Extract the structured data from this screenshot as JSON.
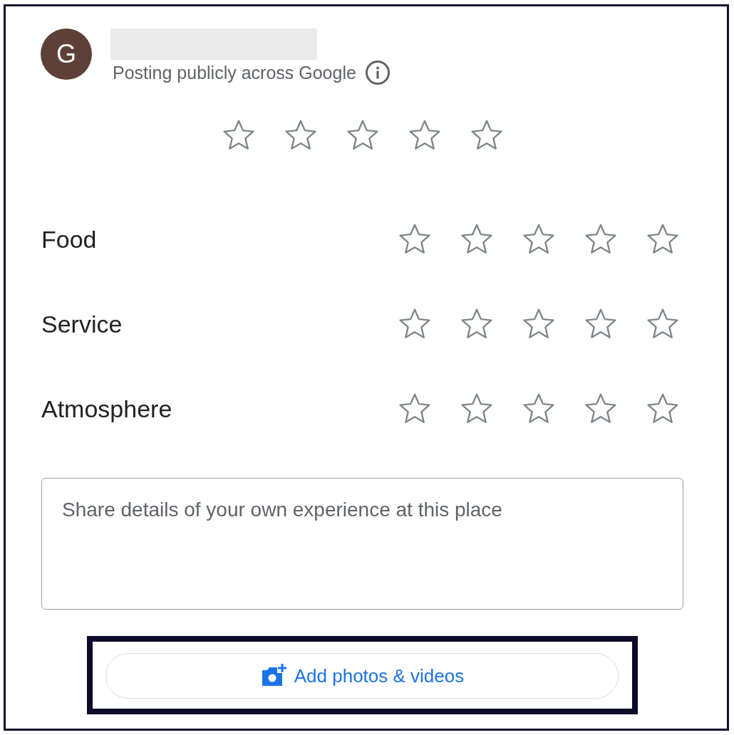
{
  "header": {
    "avatar": {
      "initial": "G"
    },
    "name_redacted": true,
    "subtitle": "Posting publicly across Google"
  },
  "overall_rating": {
    "stars": 0
  },
  "categories": [
    {
      "label": "Food",
      "stars": 0
    },
    {
      "label": "Service",
      "stars": 0
    },
    {
      "label": "Atmosphere",
      "stars": 0
    }
  ],
  "review_field": {
    "placeholder": "Share details of your own experience at this place"
  },
  "add_media_button": {
    "label": "Add photos & videos",
    "highlighted": true
  }
}
